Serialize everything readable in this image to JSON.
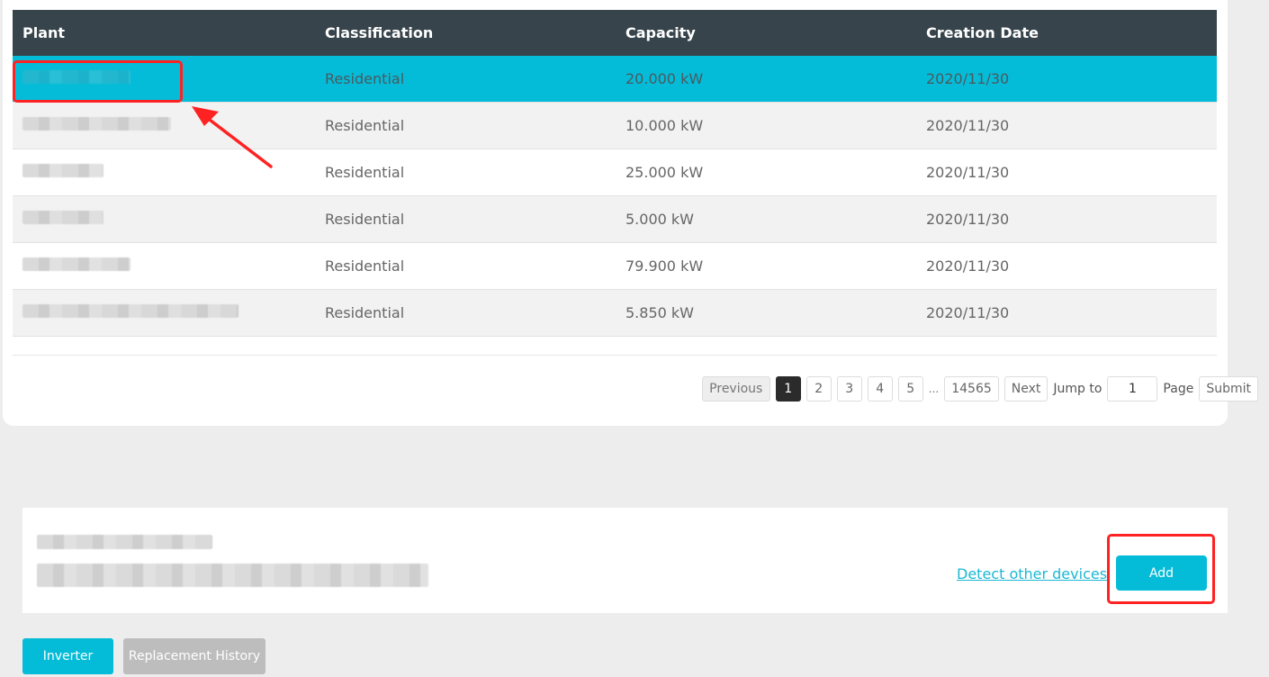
{
  "table": {
    "headers": [
      "Plant",
      "Classification",
      "Capacity",
      "Creation Date"
    ],
    "rows": [
      {
        "classification": "Residential",
        "capacity": "20.000 kW",
        "date": "2020/11/30"
      },
      {
        "classification": "Residential",
        "capacity": "10.000 kW",
        "date": "2020/11/30"
      },
      {
        "classification": "Residential",
        "capacity": "25.000 kW",
        "date": "2020/11/30"
      },
      {
        "classification": "Residential",
        "capacity": "5.000 kW",
        "date": "2020/11/30"
      },
      {
        "classification": "Residential",
        "capacity": "79.900 kW",
        "date": "2020/11/30"
      },
      {
        "classification": "Residential",
        "capacity": "5.850 kW",
        "date": "2020/11/30"
      }
    ]
  },
  "pager": {
    "previous": "Previous",
    "pages": [
      "1",
      "2",
      "3",
      "4",
      "5"
    ],
    "ellipsis": "...",
    "last": "14565",
    "next": "Next",
    "jump_to": "Jump to",
    "jump_value": "1",
    "page": "Page",
    "submit": "Submit"
  },
  "device_panel": {
    "detect_link": "Detect other devices",
    "add_label": "Add"
  },
  "bottom_tabs": {
    "inverter": "Inverter",
    "replacement_history": "Replacement History"
  },
  "colors": {
    "header_bg": "#37444b",
    "selected_row": "#05bcd8",
    "accent": "#05bcd8",
    "annotation": "#ff2222"
  }
}
